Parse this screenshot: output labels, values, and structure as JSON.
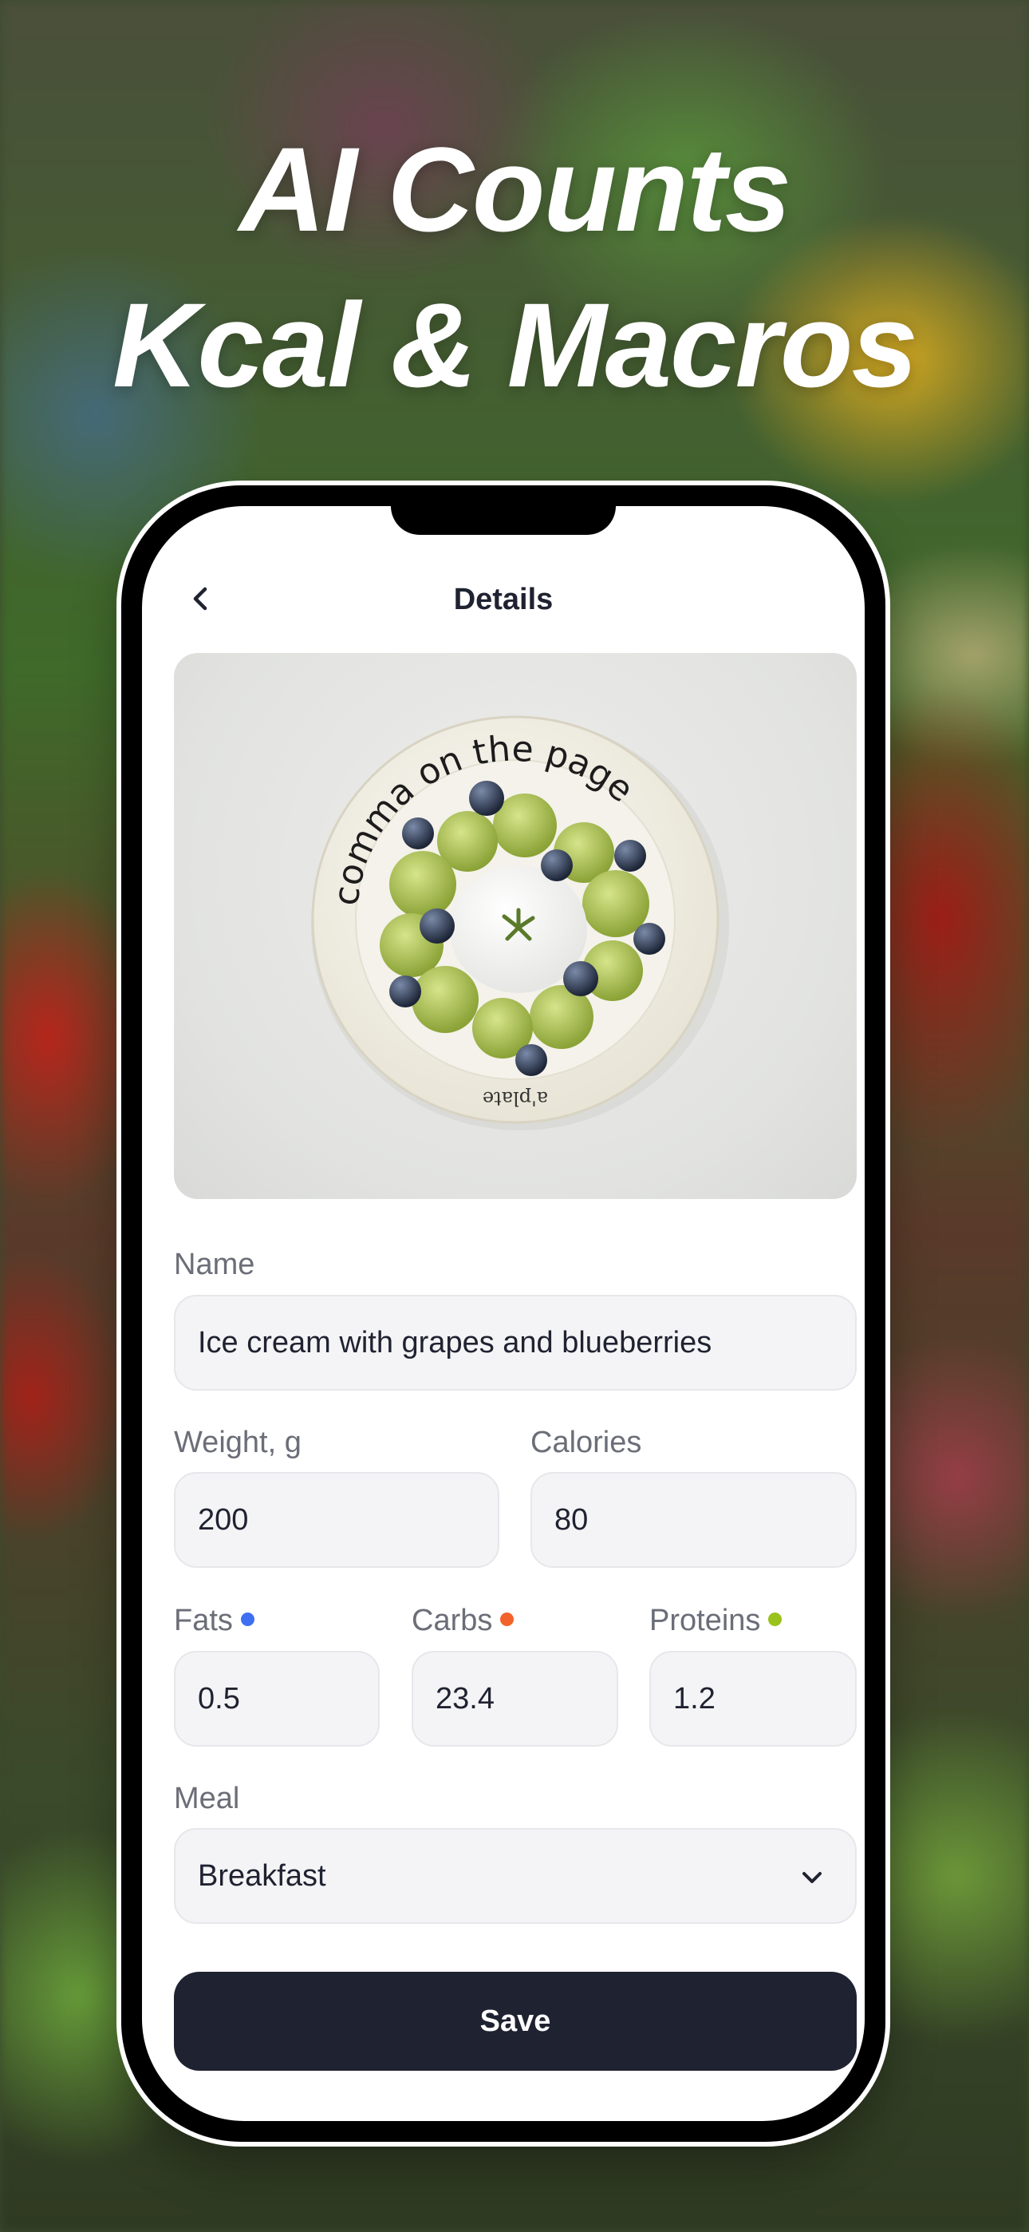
{
  "headline": {
    "line1": "AI Counts",
    "line2": "Kcal & Macros"
  },
  "nav": {
    "back_icon": "chevron-left-icon",
    "title": "Details"
  },
  "photo": {
    "description_icon": "food-photo",
    "plate_text": "comma on the page",
    "plate_brand": "a'plate"
  },
  "form": {
    "name": {
      "label": "Name",
      "value": "Ice cream with grapes and blueberries"
    },
    "weight": {
      "label": "Weight, g",
      "value": "200"
    },
    "calories": {
      "label": "Calories",
      "value": "80"
    },
    "fats": {
      "label": "Fats",
      "value": "0.5",
      "color": "#3d6ff0"
    },
    "carbs": {
      "label": "Carbs",
      "value": "23.4",
      "color": "#f2622a"
    },
    "proteins": {
      "label": "Proteins",
      "value": "1.2",
      "color": "#9ac21c"
    },
    "meal": {
      "label": "Meal",
      "value": "Breakfast",
      "icon": "chevron-down-icon"
    }
  },
  "actions": {
    "save_label": "Save"
  },
  "colors": {
    "primary_button": "#1f2230",
    "field_bg": "#f4f4f6"
  }
}
